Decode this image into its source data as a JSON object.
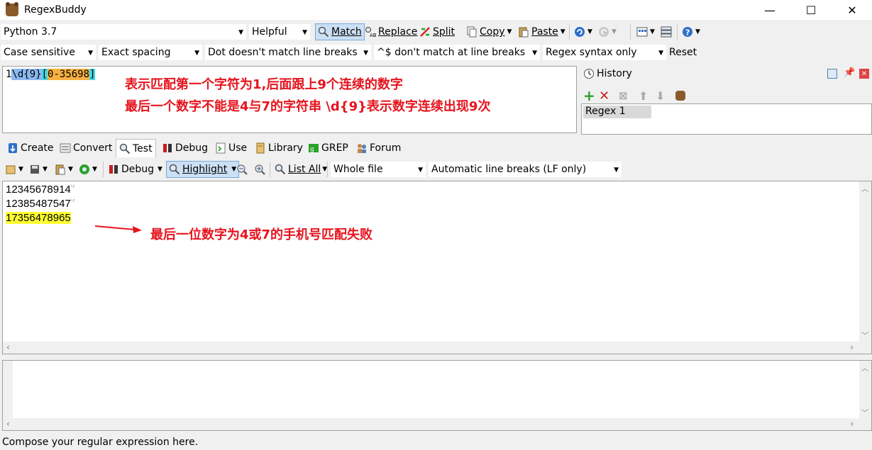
{
  "window": {
    "title": "RegexBuddy",
    "minimize": "—",
    "maximize": "☐",
    "close": "✕"
  },
  "toolbar1": {
    "flavor": "Python 3.7",
    "helpfulness": "Helpful",
    "match": "Match",
    "replace": "Replace",
    "split": "Split",
    "copy": "Copy",
    "paste": "Paste"
  },
  "toolbar2": {
    "case": "Case sensitive",
    "spacing": "Exact spacing",
    "dot": "Dot doesn't match line breaks",
    "anchors": "^$ don't match at line breaks",
    "syntax": "Regex syntax only",
    "reset": "Reset"
  },
  "regex": {
    "tokens": [
      {
        "text": "1",
        "style": "plain"
      },
      {
        "text": "\\d{9}",
        "style": "blue"
      },
      {
        "text": "[",
        "style": "cyan"
      },
      {
        "text": "0-35698",
        "style": "orange"
      },
      {
        "text": "]",
        "style": "cyan"
      }
    ],
    "annotation_line1": "表示匹配第一个字符为1,后面跟上9个连续的数字",
    "annotation_line2": "最后一个数字不能是4与7的字符串   \\d{9}表示数字连续出现9次"
  },
  "history": {
    "title": "History",
    "items": [
      "Regex 1"
    ]
  },
  "tabs": [
    "Create",
    "Convert",
    "Test",
    "Debug",
    "Use",
    "Library",
    "GREP",
    "Forum"
  ],
  "test_toolbar": {
    "debug": "Debug",
    "highlight": "Highlight",
    "list_all": "List All",
    "scope": "Whole file",
    "line_breaks": "Automatic line breaks (LF only)"
  },
  "test_subject": {
    "lines": [
      "12345678914",
      "12385487547",
      "17356478965"
    ],
    "annotation": "最后一位数字为4或7的手机号匹配失败"
  },
  "status": "Compose your regular expression here.",
  "colors": {
    "annotation": "#e6141e",
    "match_highlight": "#ffff33",
    "regex_blue": "#8bb9f0",
    "regex_orange": "#f5b041",
    "regex_cyan": "#3fd8e8"
  }
}
